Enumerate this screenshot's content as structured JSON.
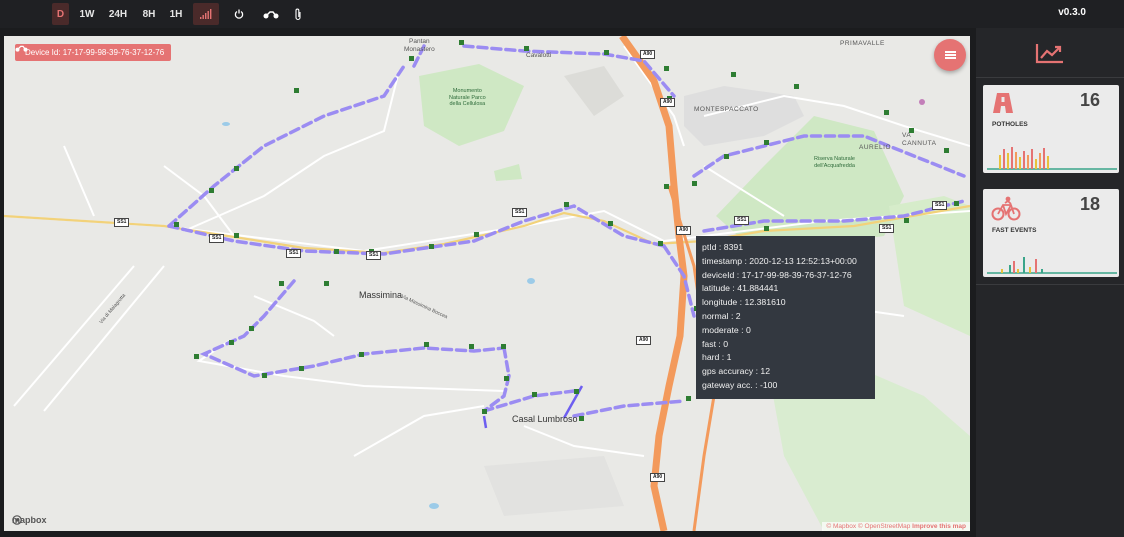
{
  "toolbar": {
    "buttons": [
      {
        "label": "D",
        "active": true
      },
      {
        "label": "1W"
      },
      {
        "label": "24H"
      },
      {
        "label": "8H"
      },
      {
        "label": "1H"
      }
    ],
    "icons": [
      "signal-icon",
      "power-icon",
      "motorcycle-icon",
      "paperclip-icon"
    ],
    "version": "v0.3.0"
  },
  "device": {
    "label": "Device Id: 17-17-99-98-39-76-37-12-76"
  },
  "map": {
    "places": {
      "massimina": "Massimina",
      "casal_lumbroso": "Casal Lumbroso",
      "primavalle": "PRIMAVALLE",
      "montespaccato": "MONTESPACCATO",
      "aurelio": "AURELIO",
      "cannuta": "VA\nCANNUTA",
      "pantan_monastero": "Pantan\nMonastero",
      "cavalotti": "Cavalotti"
    },
    "parks": {
      "cellulosa": "Monumento\nNaturale Parco\ndella Cellulosa",
      "acquafredda": "Riserva Naturale\ndell'Acquafredda"
    },
    "roads": {
      "via_malagrotta": "Via di Malagrotta",
      "via_boccea": "Via Massimina Boccea"
    },
    "shields": [
      "SS1",
      "SS1",
      "SS1",
      "SS1",
      "SS1",
      "SS1",
      "SS1",
      "A90",
      "A90",
      "A90",
      "A90",
      "A90",
      "SS1"
    ],
    "logo": "mapbox",
    "attribution": "© Mapbox © OpenStreetMap",
    "improve": "Improve this map"
  },
  "tooltip": {
    "lines": [
      "ptId : 8391",
      "timestamp : 2020-12-13 12:52:13+00:00",
      "deviceId : 17-17-99-98-39-76-37-12-76",
      "latitude : 41.884441",
      "longitude : 12.381610",
      "normal : 2",
      "moderate : 0",
      "fast : 0",
      "hard : 1",
      "gps accuracy : 12",
      "gateway acc. : -100"
    ]
  },
  "sidebar": {
    "top_icon": "trending-up-icon",
    "cards": [
      {
        "title": "POTHOLES",
        "count": "16",
        "icon": "road-icon"
      },
      {
        "title": "FAST EVENTS",
        "count": "18",
        "icon": "bicycle-icon"
      }
    ]
  },
  "colors": {
    "accent": "#e57373",
    "highway": "#f39a5c",
    "route": "#9b8cf2",
    "green": "#cfe8c4",
    "marker": "#2e7d32"
  }
}
